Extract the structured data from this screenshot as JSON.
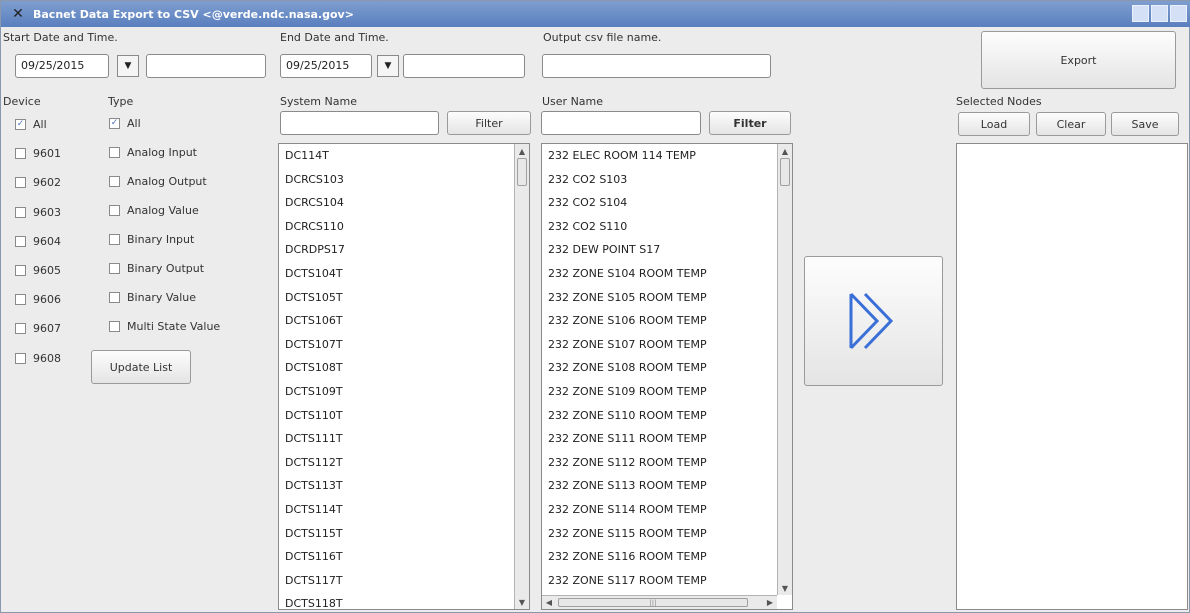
{
  "window": {
    "title": "Bacnet Data Export to CSV <@verde.ndc.nasa.gov>"
  },
  "start": {
    "label": "Start Date and Time.",
    "date": "09/25/2015",
    "time": ""
  },
  "end": {
    "label": "End Date and Time.",
    "date": "09/25/2015",
    "time": ""
  },
  "output": {
    "label": "Output csv file name.",
    "value": ""
  },
  "export_label": "Export",
  "device": {
    "header": "Device",
    "items": [
      {
        "label": "All",
        "checked": true
      },
      {
        "label": "9601",
        "checked": false
      },
      {
        "label": "9602",
        "checked": false
      },
      {
        "label": "9603",
        "checked": false
      },
      {
        "label": "9604",
        "checked": false
      },
      {
        "label": "9605",
        "checked": false
      },
      {
        "label": "9606",
        "checked": false
      },
      {
        "label": "9607",
        "checked": false
      },
      {
        "label": "9608",
        "checked": false
      }
    ]
  },
  "type": {
    "header": "Type",
    "items": [
      {
        "label": "All",
        "checked": true
      },
      {
        "label": "Analog Input",
        "checked": false
      },
      {
        "label": "Analog Output",
        "checked": false
      },
      {
        "label": "Analog Value",
        "checked": false
      },
      {
        "label": "Binary Input",
        "checked": false
      },
      {
        "label": "Binary Output",
        "checked": false
      },
      {
        "label": "Binary Value",
        "checked": false
      },
      {
        "label": "Multi State Value",
        "checked": false
      }
    ]
  },
  "update_label": "Update List",
  "system": {
    "header": "System Name",
    "filter_label": "Filter",
    "filter_value": "",
    "items": [
      "DC114T",
      "DCRCS103",
      "DCRCS104",
      "DCRCS110",
      "DCRDPS17",
      "DCTS104T",
      "DCTS105T",
      "DCTS106T",
      "DCTS107T",
      "DCTS108T",
      "DCTS109T",
      "DCTS110T",
      "DCTS111T",
      "DCTS112T",
      "DCTS113T",
      "DCTS114T",
      "DCTS115T",
      "DCTS116T",
      "DCTS117T",
      "DCTS118T"
    ]
  },
  "user": {
    "header": "User Name",
    "filter_label": "Filter",
    "filter_value": "",
    "items": [
      "232 ELEC ROOM 114 TEMP",
      "232 CO2 S103",
      "232 CO2 S104",
      "232 CO2 S110",
      "232 DEW POINT S17",
      "232 ZONE S104 ROOM TEMP",
      "232 ZONE S105 ROOM TEMP",
      "232 ZONE S106 ROOM TEMP",
      "232 ZONE S107 ROOM TEMP",
      "232 ZONE S108 ROOM TEMP",
      "232 ZONE S109 ROOM TEMP",
      "232 ZONE S110 ROOM TEMP",
      "232 ZONE S111 ROOM TEMP",
      "232 ZONE S112 ROOM TEMP",
      "232 ZONE S113 ROOM TEMP",
      "232 ZONE S114 ROOM TEMP",
      "232 ZONE S115 ROOM TEMP",
      "232 ZONE S116 ROOM TEMP",
      "232 ZONE S117 ROOM TEMP"
    ]
  },
  "selected": {
    "header": "Selected Nodes",
    "load_label": "Load",
    "clear_label": "Clear",
    "save_label": "Save"
  },
  "colors": {
    "arrow": "#3a6fd8",
    "titlebar": "#6b8fc9"
  }
}
